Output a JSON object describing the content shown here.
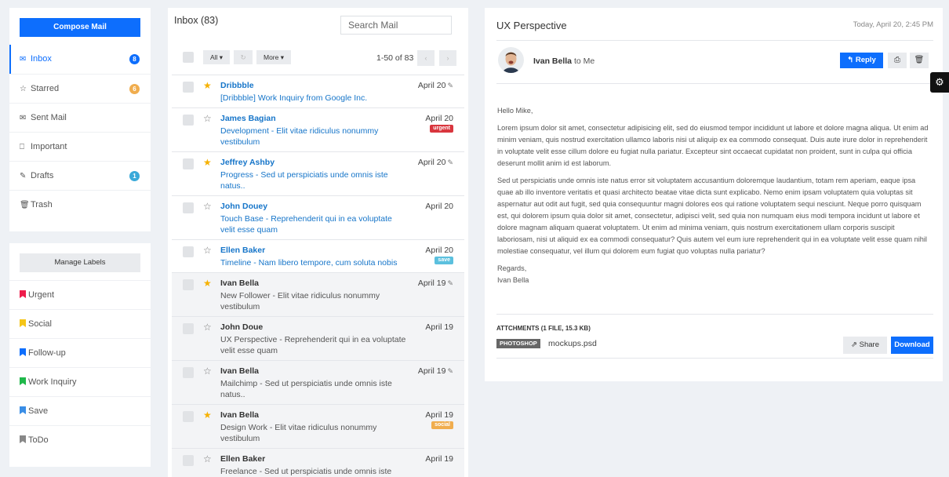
{
  "sidebar": {
    "compose_label": "Compose Mail",
    "nav": [
      {
        "label": "Inbox",
        "icon": "envelope-icon",
        "glyph": "✉",
        "count": "8",
        "color": "#0d6efd",
        "active": true
      },
      {
        "label": "Starred",
        "icon": "star-outline-icon",
        "glyph": "☆",
        "count": "6",
        "color": "#f0ad4e"
      },
      {
        "label": "Sent Mail",
        "icon": "sent-mail-icon",
        "glyph": "✉",
        "count": ""
      },
      {
        "label": "Important",
        "icon": "bookmark-icon",
        "glyph": "⎕",
        "count": ""
      },
      {
        "label": "Drafts",
        "icon": "edit-icon",
        "glyph": "✎",
        "count": "1",
        "color": "#3aa9d9"
      },
      {
        "label": "Trash",
        "icon": "trash-icon",
        "glyph": "🗑",
        "count": ""
      }
    ],
    "manage_labels": "Manage Labels",
    "labels": [
      {
        "label": "Urgent",
        "color": "#ee1c4b"
      },
      {
        "label": "Social",
        "color": "#f5c518"
      },
      {
        "label": "Follow-up",
        "color": "#0d6efd"
      },
      {
        "label": "Work Inquiry",
        "color": "#1fb84a"
      },
      {
        "label": "Save",
        "color": "#3a8ee6"
      },
      {
        "label": "ToDo",
        "color": "#888888"
      }
    ]
  },
  "inbox": {
    "title": "Inbox (83)",
    "search_placeholder": "Search Mail",
    "toolbar": {
      "all_label": "All ▾",
      "more_label": "More ▾",
      "range": "1-50 of 83"
    },
    "mails": [
      {
        "sender": "Dribbble",
        "subject": "[Dribbble] Work Inquiry from Google Inc.",
        "date": "April 20",
        "starred": true,
        "clip": true,
        "unread": true,
        "short": true
      },
      {
        "sender": "James Bagian",
        "subject": "Development - Elit vitae ridiculus nonummy vestibulum",
        "date": "April 20",
        "starred": false,
        "unread": true,
        "tag": "urgent",
        "tag_color": "#d9363e"
      },
      {
        "sender": "Jeffrey Ashby",
        "subject": "Progress - Sed ut perspiciatis unde omnis iste natus..",
        "date": "April 20",
        "starred": true,
        "clip": true,
        "unread": true
      },
      {
        "sender": "John Douey",
        "subject": "Touch Base - Reprehenderit qui in ea voluptate velit esse quam",
        "date": "April 20",
        "starred": false,
        "unread": true
      },
      {
        "sender": "Ellen Baker",
        "subject": "Timeline - Nam libero tempore, cum soluta nobis",
        "date": "April 20",
        "starred": false,
        "unread": true,
        "tag": "save",
        "tag_color": "#5bc0de",
        "short": true
      },
      {
        "sender": "Ivan Bella",
        "subject": "New Follower - Elit vitae ridiculus nonummy vestibulum",
        "date": "April 19",
        "starred": true,
        "clip": true,
        "unread": false
      },
      {
        "sender": "John Doue",
        "subject": "UX Perspective - Reprehenderit qui in ea voluptate velit esse quam",
        "date": "April 19",
        "starred": false,
        "unread": false
      },
      {
        "sender": "Ivan Bella",
        "subject": "Mailchimp - Sed ut perspiciatis unde omnis iste natus..",
        "date": "April 19",
        "starred": false,
        "clip": true,
        "unread": false
      },
      {
        "sender": "Ivan Bella",
        "subject": "Design Work - Elit vitae ridiculus nonummy vestibulum",
        "date": "April 19",
        "starred": true,
        "unread": false,
        "tag": "social",
        "tag_color": "#f0ad4e"
      },
      {
        "sender": "Ellen Baker",
        "subject": "Freelance - Sed ut perspiciatis unde omnis iste",
        "date": "April 19",
        "starred": false,
        "unread": false
      }
    ]
  },
  "reader": {
    "title": "UX Perspective",
    "date": "Today, April 20, 2:45 PM",
    "from_name": "Ivan Bella",
    "to_text": "to Me",
    "reply_label": "Reply",
    "greeting": "Hello Mike,",
    "p1": "Lorem ipsum dolor sit amet, consectetur adipisicing elit, sed do eiusmod tempor incididunt ut labore et dolore magna aliqua. Ut enim ad minim veniam, quis nostrud exercitation ullamco laboris nisi ut aliquip ex ea commodo consequat. Duis aute irure dolor in reprehenderit in voluptate velit esse cillum dolore eu fugiat nulla pariatur. Excepteur sint occaecat cupidatat non proident, sunt in culpa qui officia deserunt mollit anim id est laborum.",
    "p2": "Sed ut perspiciatis unde omnis iste natus error sit voluptatem accusantium doloremque laudantium, totam rem aperiam, eaque ipsa quae ab illo inventore veritatis et quasi architecto beatae vitae dicta sunt explicabo. Nemo enim ipsam voluptatem quia voluptas sit aspernatur aut odit aut fugit, sed quia consequuntur magni dolores eos qui ratione voluptatem sequi nesciunt. Neque porro quisquam est, qui dolorem ipsum quia dolor sit amet, consectetur, adipisci velit, sed quia non numquam eius modi tempora incidunt ut labore et dolore magnam aliquam quaerat voluptatem. Ut enim ad minima veniam, quis nostrum exercitationem ullam corporis suscipit laboriosam, nisi ut aliquid ex ea commodi consequatur? Quis autem vel eum iure reprehenderit qui in ea voluptate velit esse quam nihil molestiae consequatur, vel illum qui dolorem eum fugiat quo voluptas nulla pariatur?",
    "regards": "Regards,",
    "signature": "Ivan Bella",
    "attachments_title": "ATTCHMENTS (1 FILE, 15.3 KB)",
    "attachment_type": "PHOTOSHOP",
    "attachment_name": "mockups.psd",
    "share_label": "Share",
    "download_label": "Download"
  }
}
